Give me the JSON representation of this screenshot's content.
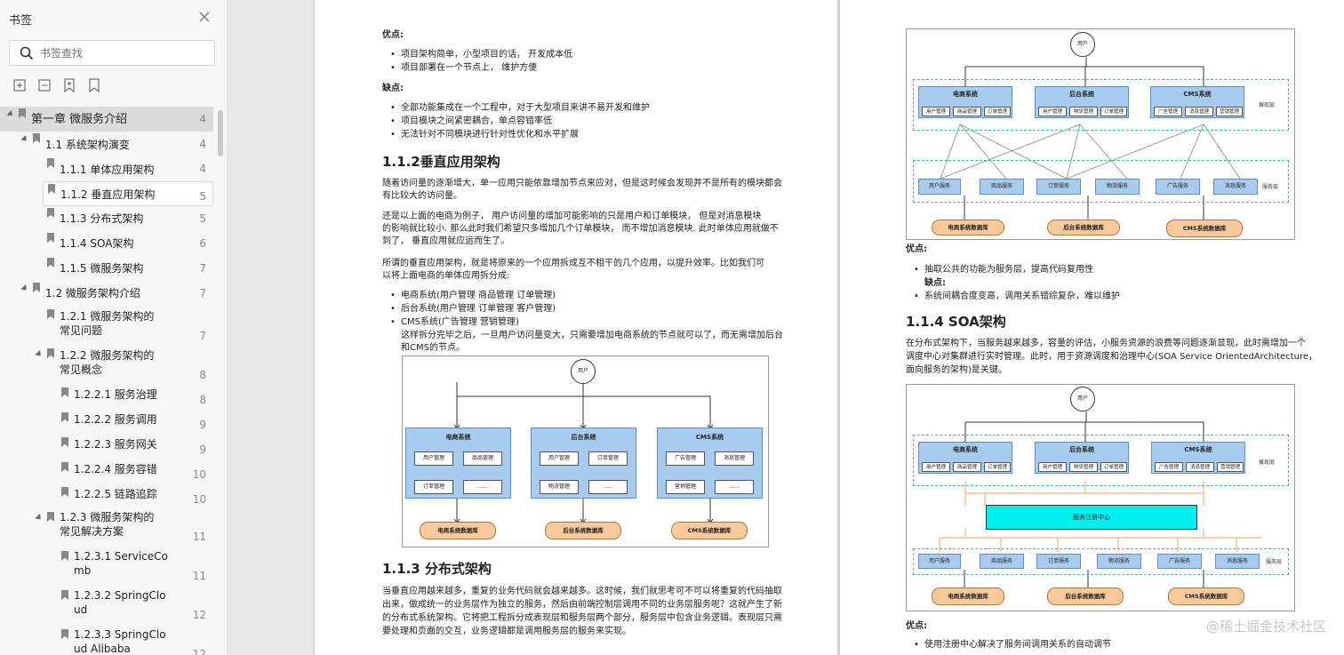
{
  "sidebar": {
    "title": "书签",
    "search_placeholder": "书签查找",
    "toc": [
      {
        "label": "第一章 微服务介绍",
        "page": "4"
      },
      {
        "label": "1.1 系统架构演变",
        "page": "4"
      },
      {
        "label": "1.1.1 单体应用架构",
        "page": "4"
      },
      {
        "label": "1.1.2 垂直应用架构",
        "page": "5"
      },
      {
        "label": "1.1.3 分布式架构",
        "page": "5"
      },
      {
        "label": "1.1.4 SOA架构",
        "page": "6"
      },
      {
        "label": "1.1.5 微服务架构",
        "page": "7"
      },
      {
        "label": "1.2 微服务架构介绍",
        "page": "7"
      },
      {
        "label": "1.2.1 微服务架构的\n常见问题",
        "page": "7"
      },
      {
        "label": "1.2.2 微服务架构的\n常见概念",
        "page": "8"
      },
      {
        "label": "1.2.2.1 服务治理",
        "page": "8"
      },
      {
        "label": "1.2.2.2 服务调用",
        "page": "9"
      },
      {
        "label": "1.2.2.3 服务网关",
        "page": "9"
      },
      {
        "label": "1.2.2.4 服务容错",
        "page": "10"
      },
      {
        "label": "1.2.2.5 链路追踪",
        "page": "10"
      },
      {
        "label": "1.2.3 微服务架构的\n常见解决方案",
        "page": "11"
      },
      {
        "label": "1.2.3.1 ServiceCo\nmb",
        "page": "11"
      },
      {
        "label": "1.2.3.2 SpringClo\nud",
        "page": "12"
      },
      {
        "label": "1.2.3.3 SpringClo\nud Alibaba",
        "page": "12"
      }
    ]
  },
  "left_page": {
    "pros_title": "优点:",
    "pros": [
      "项目架构简单，小型项目的话， 开发成本低",
      "项目部署在一个节点上， 维护方便"
    ],
    "cons_title": "缺点:",
    "cons": [
      "全部功能集成在一个工程中，对于大型项目来讲不易开发和维护",
      "项目模块之间紧密耦合，单点容错率低",
      "无法针对不同模块进行针对性优化和水平扩展"
    ],
    "h_vertical": "1.1.2垂直应用架构",
    "p1_l1": "随着访问量的逐渐增大，单一应用只能依靠增加节点来应对，但是这时候会发现并不是所有的模块都会",
    "p1_l2": "有比较大的访问量。",
    "p2_l1": "还是以上面的电商为例子， 用户访问量的增加可能影响的只是用户和订单模块， 但是对消息模块",
    "p2_l2": "的影响就比较小. 那么此时我们希望只多增加几个订单模块， 而不增加消息模块. 此时单体应用就做不",
    "p2_l3": "到了， 垂直应用就应运而生了。",
    "p3_l1": "所谓的垂直应用架构，就是将原来的一个应用拆成互不相干的几个应用，以提升效率。比如我们可",
    "p3_l2": "以将上面电商的单体应用拆分成:",
    "split": [
      "电商系统(用户管理 商品管理 订单管理)",
      "后台系统(用户管理 订单管理 客户管理)",
      "CMS系统(广告管理 营销管理)"
    ],
    "split_note_l1": "这样拆分完毕之后，一旦用户访问量变大，只需要增加电商系统的节点就可以了，而无需增加后台",
    "split_note_l2": "和CMS的节点。",
    "h_distributed": "1.1.3 分布式架构",
    "p4_l1": "当垂直应用越来越多，重复的业务代码就会越来越多。这时候，我们就思考可不可以将重复的代码抽取",
    "p4_l2": "出来，做成统一的业务层作为独立的服务，然后由前端控制层调用不同的业务层服务呢？这就产生了新",
    "p4_l3": "的分布式系统架构。它将把工程拆分成表现层和服务层两个部分，服务层中包含业务逻辑。表现层只需",
    "p4_l4": "要处理和页面的交互，业务逻辑都是调用服务层的服务来实现。",
    "diagram": {
      "user": "用户",
      "systems": [
        {
          "name": "电商系统",
          "boxes": [
            "用户管理",
            "商品管理",
            "订单管理",
            "......"
          ]
        },
        {
          "name": "后台系统",
          "boxes": [
            "用户管理",
            "订单管理",
            "物流管理",
            "......"
          ]
        },
        {
          "name": "CMS系统",
          "boxes": [
            "广告管理",
            "消息管理",
            "营销管理",
            "......"
          ]
        }
      ],
      "dbs": [
        "电商系统数据库",
        "后台系统数据库",
        "CMS系统数据库"
      ]
    }
  },
  "right_page": {
    "d1": {
      "user": "用户",
      "systems": [
        {
          "name": "电商系统",
          "boxes": [
            "用户管理",
            "商品管理",
            "订单管理"
          ]
        },
        {
          "name": "后台系统",
          "boxes": [
            "用户管理",
            "物流管理",
            "订单管理"
          ]
        },
        {
          "name": "CMS系统",
          "boxes": [
            "广告管理",
            "消息管理",
            "营销管理"
          ]
        }
      ],
      "layer_present": "展现层",
      "layer_service": "服务层",
      "services": [
        "用户服务",
        "商品服务",
        "订单服务",
        "物流服务",
        "广告服务",
        "消息服务"
      ],
      "dbs": [
        "电商系统数据库",
        "后台系统数据库",
        "CMS系统数据库"
      ]
    },
    "pros_title": "优点:",
    "pros_1": "抽取公共的功能为服务层，提高代码复用性",
    "cons_title": "缺点:",
    "cons_1": "系统间耦合度变高，调用关系错综复杂，难以维护",
    "h_soa": "1.1.4 SOA架构",
    "p_soa_l1": "在分布式架构下，当服务越来越多，容量的评估，小服务资源的浪费等问题逐渐显现，此时需增加一个",
    "p_soa_l2": "调度中心对集群进行实时管理。此时，用于资源调度和治理中心(SOA Service OrientedArchitecture，",
    "p_soa_l3": "面向服务的架构)是关键。",
    "d2": {
      "user": "用户",
      "systems": [
        {
          "name": "电商系统",
          "boxes": [
            "用户管理",
            "商品管理",
            "订单管理"
          ]
        },
        {
          "name": "后台系统",
          "boxes": [
            "用户管理",
            "物流管理",
            "订单管理"
          ]
        },
        {
          "name": "CMS系统",
          "boxes": [
            "广告管理",
            "消息管理",
            "营销管理"
          ]
        }
      ],
      "registry": "服务注册中心",
      "layer_present": "展现层",
      "layer_service": "服务层",
      "services": [
        "用户服务",
        "商品服务",
        "订单服务",
        "物流服务",
        "广告服务",
        "消息服务"
      ],
      "dbs": [
        "电商系统数据库",
        "后台系统数据库",
        "CMS系统数据库"
      ]
    },
    "pros2_title": "优点:",
    "pros2_1": "使用注册中心解决了服务间调用关系的自动调节"
  },
  "watermark": "@稀土掘金技术社区"
}
